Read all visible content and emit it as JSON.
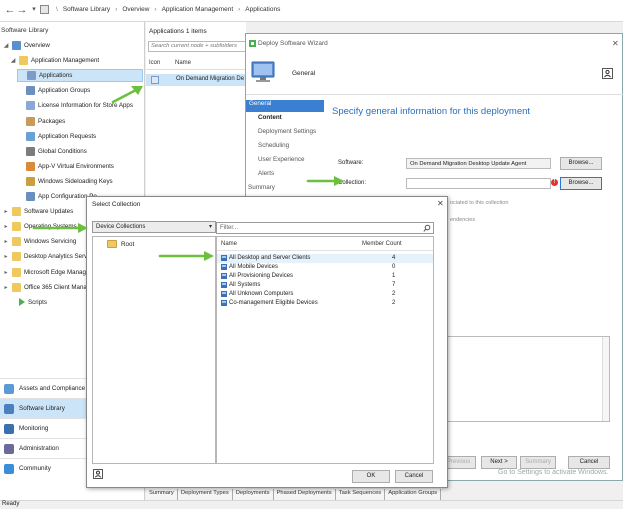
{
  "address_bar": {
    "crumbs": [
      "Software Library",
      "Overview",
      "Application Management",
      "Applications"
    ]
  },
  "nav": {
    "title": "Software Library",
    "tree": [
      {
        "label": "Overview",
        "icon": "overview-icon"
      },
      {
        "label": "Application Management",
        "icon": "folder-icon"
      },
      {
        "label": "Applications",
        "icon": "application-icon",
        "selected": true
      },
      {
        "label": "Application Groups",
        "icon": "application-group-icon"
      },
      {
        "label": "License Information for Store Apps",
        "icon": "license-icon"
      },
      {
        "label": "Packages",
        "icon": "package-icon"
      },
      {
        "label": "Application Requests",
        "icon": "request-icon"
      },
      {
        "label": "Global Conditions",
        "icon": "condition-icon"
      },
      {
        "label": "App-V Virtual Environments",
        "icon": "appv-icon"
      },
      {
        "label": "Windows Sideloading Keys",
        "icon": "key-icon"
      },
      {
        "label": "App Configuration Po",
        "icon": "config-icon"
      },
      {
        "label": "Software Updates",
        "icon": "folder-icon"
      },
      {
        "label": "Operating Systems",
        "icon": "folder-icon"
      },
      {
        "label": "Windows Servicing",
        "icon": "folder-icon"
      },
      {
        "label": "Desktop Analytics Servic",
        "icon": "folder-icon"
      },
      {
        "label": "Microsoft Edge Managem",
        "icon": "folder-icon"
      },
      {
        "label": "Office 365 Client Manag",
        "icon": "folder-icon"
      },
      {
        "label": "Scripts",
        "icon": "script-icon"
      }
    ],
    "workspaces": [
      {
        "label": "Assets and Compliance",
        "icon": "assets-icon"
      },
      {
        "label": "Software Library",
        "icon": "software-library-icon",
        "selected": true
      },
      {
        "label": "Monitoring",
        "icon": "monitoring-icon"
      },
      {
        "label": "Administration",
        "icon": "administration-icon"
      },
      {
        "label": "Community",
        "icon": "community-icon"
      }
    ]
  },
  "list_pane": {
    "header": "Applications 1 items",
    "search_placeholder": "Search current node + subfolders",
    "columns": [
      "Icon",
      "Name"
    ],
    "row_name": "On Demand Migration De"
  },
  "bottom_tabs": [
    "Summary",
    "Deployment Types",
    "Deployments",
    "Phased Deployments",
    "Task Sequences",
    "Application Groups"
  ],
  "status": "Ready",
  "wizard": {
    "title": "Deploy Software Wizard",
    "page": "General",
    "heading": "Specify general information for this deployment",
    "steps": [
      {
        "label": "General",
        "type": "active"
      },
      {
        "label": "Content",
        "type": "bold"
      },
      {
        "label": "Deployment Settings",
        "type": "sub"
      },
      {
        "label": "Scheduling",
        "type": "sub"
      },
      {
        "label": "User Experience",
        "type": "sub"
      },
      {
        "label": "Alerts",
        "type": "sub"
      },
      {
        "label": "Summary",
        "type": "main"
      }
    ],
    "software_label": "Software:",
    "software_value": "On Demand Migration Desktop Update Agent",
    "collection_label": "Collection:",
    "collection_value": "",
    "browse_label": "Browse...",
    "ghost_text_1": "ociated to this collection",
    "ghost_text_2": "endencies",
    "prev_label": "< Previous",
    "next_label": "Next >",
    "summary_label": "Summary",
    "cancel_label": "Cancel",
    "watermark": "Go to Settings to activate Windows."
  },
  "select_collection": {
    "title": "Select Collection",
    "dropdown_value": "Device Collections",
    "tree_root": "Root",
    "filter_placeholder": "Filter...",
    "columns": [
      "Name",
      "Member Count"
    ],
    "rows": [
      {
        "name": "All Desktop and Server Clients",
        "count": "4"
      },
      {
        "name": "All Mobile Devices",
        "count": "0"
      },
      {
        "name": "All Provisioning Devices",
        "count": "1"
      },
      {
        "name": "All Systems",
        "count": "7"
      },
      {
        "name": "All Unknown Computers",
        "count": "2"
      },
      {
        "name": "Co-management Eligible Devices",
        "count": "2"
      }
    ],
    "ok_label": "OK",
    "cancel_label": "Cancel"
  },
  "colors": {
    "accent": "#3b7fd0",
    "heading": "#2a6fc0",
    "arrow": "#6cbf3f",
    "selection": "#cce4f7"
  }
}
